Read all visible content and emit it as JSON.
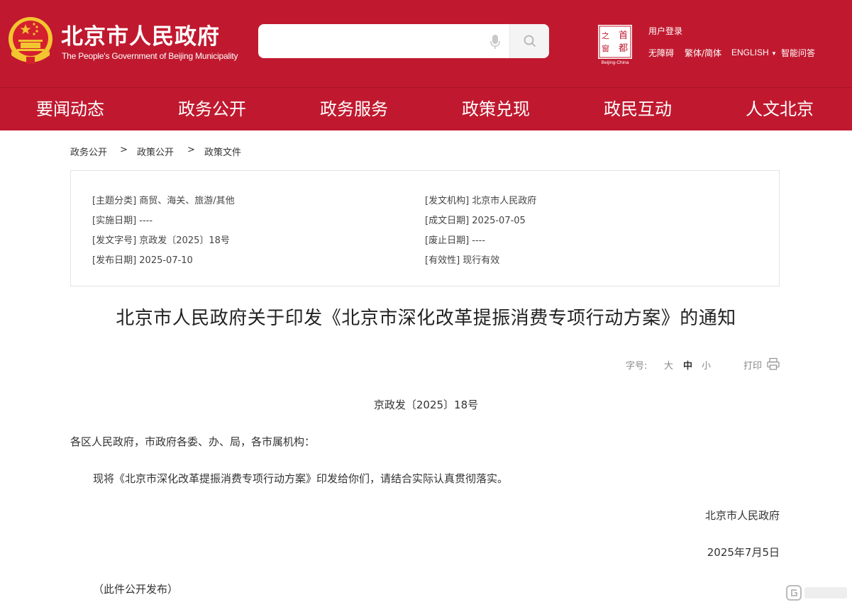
{
  "header": {
    "site_title": "北京市人民政府",
    "site_subtitle": "The People's Government of Beijing Municipality",
    "search": {
      "placeholder": ""
    },
    "capital_logo_text": "Beijing-China",
    "links": {
      "login": "用户登录",
      "accessibility": "无障碍",
      "traditional": "繁体/简体",
      "english": "ENGLISH",
      "smart_qa": "智能问答"
    }
  },
  "nav": {
    "items": [
      "要闻动态",
      "政务公开",
      "政务服务",
      "政策兑现",
      "政民互动",
      "人文北京"
    ]
  },
  "breadcrumb": {
    "items": [
      "政务公开",
      "政策公开",
      "政策文件"
    ],
    "separator": ">"
  },
  "meta": {
    "topic": "[主题分类] 商贸、海关、旅游/其他",
    "issuer": "[发文机构] 北京市人民政府",
    "effective_date": "[实施日期] ----",
    "written_date": "[成文日期] 2025-07-05",
    "doc_number": "[发文字号] 京政发〔2025〕18号",
    "expiry_date": "[废止日期] ----",
    "publish_date": "[发布日期] 2025-07-10",
    "validity": "[有效性] 现行有效"
  },
  "article": {
    "title": "北京市人民政府关于印发《北京市深化改革提振消费专项行动方案》的通知",
    "font_size_label": "字号:",
    "font_sizes": [
      "大",
      "中",
      "小"
    ],
    "print_label": "打印",
    "doc_number": "京政发〔2025〕18号",
    "addressee": "各区人民政府，市政府各委、办、局，各市属机构：",
    "body": "现将《北京市深化改革提振消费专项行动方案》印发给你们，请结合实际认真贯彻落实。",
    "signature": "北京市人民政府",
    "date": "2025年7月5日",
    "note": "（此件公开发布）"
  },
  "colors": {
    "brand_red": "#c0192f",
    "emblem_gold": "#f3c530"
  },
  "icons": [
    "national-emblem-icon",
    "microphone-icon",
    "search-icon",
    "capital-logo-icon",
    "print-icon",
    "dropdown-caret-icon"
  ]
}
